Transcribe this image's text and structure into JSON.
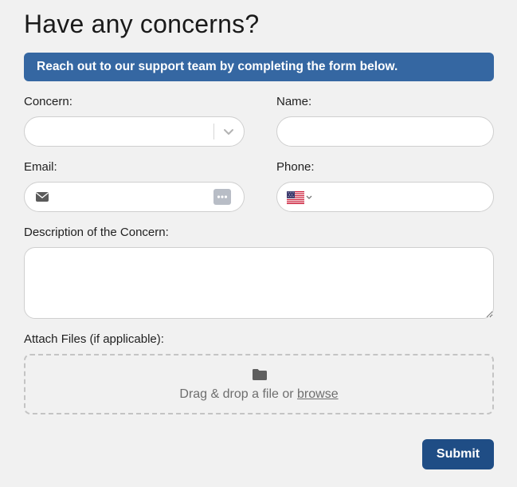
{
  "form": {
    "title": "Have any concerns?",
    "banner": "Reach out to our support team by completing the form below.",
    "concern": {
      "label": "Concern:",
      "value": ""
    },
    "name": {
      "label": "Name:",
      "value": ""
    },
    "email": {
      "label": "Email:",
      "value": ""
    },
    "phone": {
      "label": "Phone:",
      "value": "",
      "country_icon": "us-flag-icon"
    },
    "description": {
      "label": "Description of the Concern:",
      "value": ""
    },
    "attachments": {
      "label": "Attach Files (if applicable):",
      "drop_text": "Drag & drop a file or ",
      "browse_link": "browse"
    },
    "submit_label": "Submit"
  },
  "colors": {
    "background": "#f1f1f1",
    "banner": "#3567a2",
    "submit_button": "#1f4d85",
    "field_border": "#cfcfcf"
  },
  "icons": [
    "chevron-down-icon",
    "envelope-icon",
    "password-dots-icon",
    "us-flag-icon",
    "folder-icon"
  ]
}
